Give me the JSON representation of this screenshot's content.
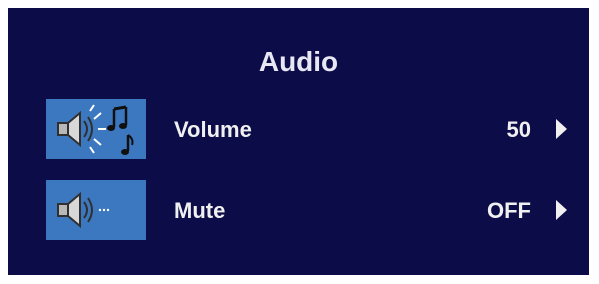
{
  "menu": {
    "title": "Audio"
  },
  "rows": [
    {
      "label": "Volume",
      "value": "50",
      "icon": "volume-speaker-music-icon",
      "arrow": "right-arrow-icon"
    },
    {
      "label": "Mute",
      "value": "OFF",
      "icon": "mute-speaker-icon",
      "arrow": "right-arrow-icon"
    }
  ],
  "colors": {
    "panel_background": "#0c0c48",
    "icon_tile": "#3c78c0",
    "text": "#f0f0f0"
  }
}
